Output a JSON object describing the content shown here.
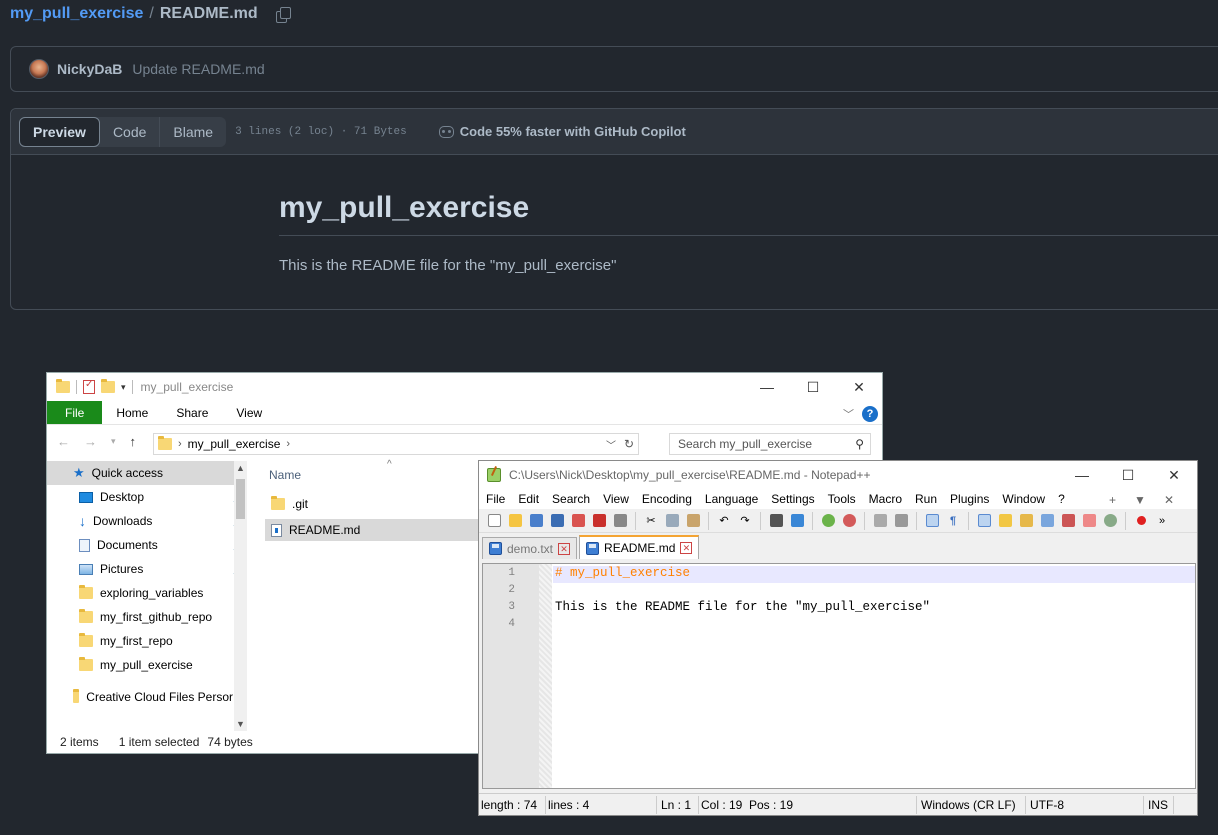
{
  "github": {
    "repo": "my_pull_exercise",
    "separator": "/",
    "file": "README.md",
    "commit_author": "NickyDaB",
    "commit_message": "Update README.md",
    "view_tabs": {
      "preview": "Preview",
      "code": "Code",
      "blame": "Blame"
    },
    "file_info": "3 lines (2 loc) · 71 Bytes",
    "copilot": "Code 55% faster with GitHub Copilot",
    "readme_heading": "my_pull_exercise",
    "readme_text": "This is the README file for the \"my_pull_exercise\""
  },
  "explorer": {
    "title": "my_pull_exercise",
    "ribbon": {
      "file": "File",
      "home": "Home",
      "share": "Share",
      "view": "View"
    },
    "address": "my_pull_exercise",
    "search_placeholder": "Search my_pull_exercise",
    "nav": [
      {
        "label": "Quick access"
      },
      {
        "label": "Desktop"
      },
      {
        "label": "Downloads"
      },
      {
        "label": "Documents"
      },
      {
        "label": "Pictures"
      },
      {
        "label": "exploring_variables"
      },
      {
        "label": "my_first_github_repo"
      },
      {
        "label": "my_first_repo"
      },
      {
        "label": "my_pull_exercise"
      },
      {
        "label": "Creative Cloud Files Persor"
      }
    ],
    "column_name": "Name",
    "files": [
      {
        "name": ".git"
      },
      {
        "name": "README.md"
      }
    ],
    "status": {
      "items": "2 items",
      "selected": "1 item selected",
      "size": "74 bytes"
    }
  },
  "notepad": {
    "title": "C:\\Users\\Nick\\Desktop\\my_pull_exercise\\README.md - Notepad++",
    "menu": [
      "File",
      "Edit",
      "Search",
      "View",
      "Encoding",
      "Language",
      "Settings",
      "Tools",
      "Macro",
      "Run",
      "Plugins",
      "Window",
      "?"
    ],
    "menu_right": [
      "+",
      "▼",
      "✕"
    ],
    "tabs": [
      {
        "label": "demo.txt"
      },
      {
        "label": "README.md"
      }
    ],
    "line_numbers": [
      "1",
      "2",
      "3",
      "4"
    ],
    "lines": [
      "# my_pull_exercise",
      "",
      "This is the README file for the \"my_pull_exercise\"",
      ""
    ],
    "status": {
      "length": "length : 74",
      "lines": "lines : 4",
      "ln": "Ln : 1",
      "col": "Col : 19",
      "pos": "Pos : 19",
      "eol": "Windows (CR LF)",
      "encoding": "UTF-8",
      "mode": "INS"
    }
  },
  "colors": {
    "gh_bg": "#22272e",
    "gh_link": "#539bf5",
    "win_file_tab": "#1a8a1a",
    "npp_header": "#ff8000"
  }
}
